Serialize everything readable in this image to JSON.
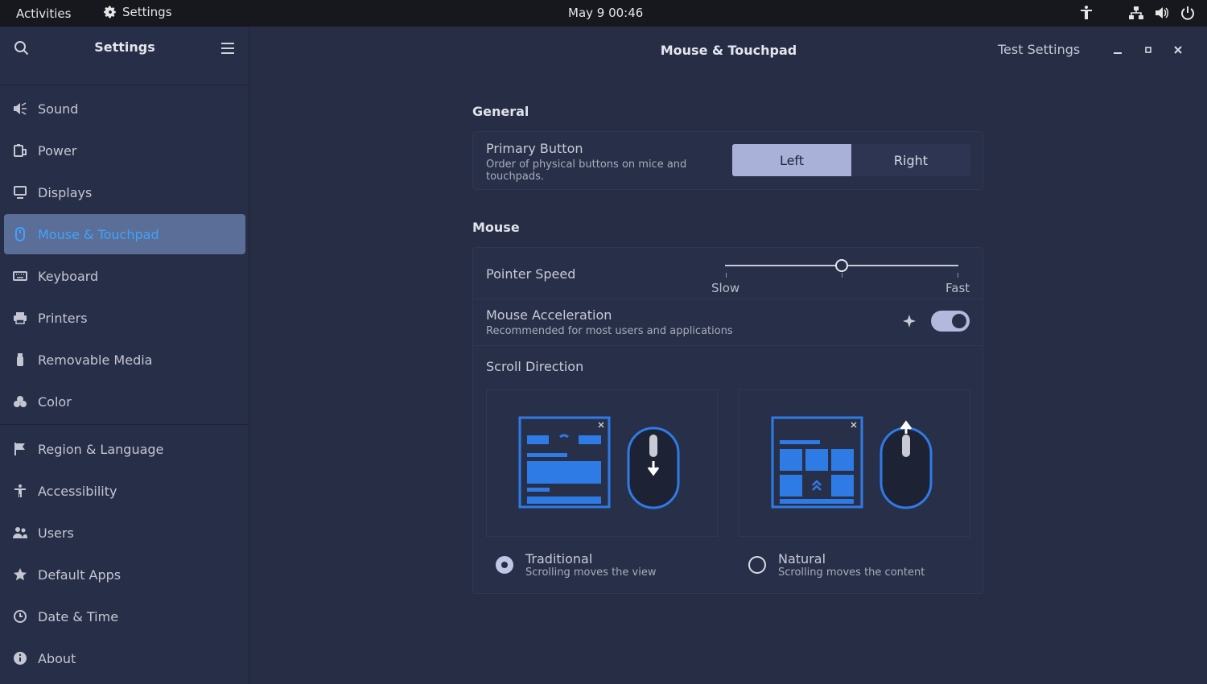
{
  "topbar": {
    "activities": "Activities",
    "app_name": "Settings",
    "clock": "May 9  00:46"
  },
  "sidebar": {
    "title": "Settings",
    "items": [
      {
        "label": "Sound",
        "icon": "speaker-icon"
      },
      {
        "label": "Power",
        "icon": "battery-icon"
      },
      {
        "label": "Displays",
        "icon": "monitor-icon"
      },
      {
        "label": "Mouse & Touchpad",
        "icon": "mouse-icon",
        "active": true
      },
      {
        "label": "Keyboard",
        "icon": "keyboard-icon"
      },
      {
        "label": "Printers",
        "icon": "printer-icon"
      },
      {
        "label": "Removable Media",
        "icon": "usb-icon"
      },
      {
        "label": "Color",
        "icon": "color-icon"
      },
      {
        "label": "Region & Language",
        "icon": "flag-icon"
      },
      {
        "label": "Accessibility",
        "icon": "accessibility-icon"
      },
      {
        "label": "Users",
        "icon": "users-icon"
      },
      {
        "label": "Default Apps",
        "icon": "star-icon"
      },
      {
        "label": "Date & Time",
        "icon": "clock-icon"
      },
      {
        "label": "About",
        "icon": "info-icon"
      }
    ]
  },
  "header": {
    "title": "Mouse & Touchpad",
    "test_button": "Test Settings"
  },
  "general": {
    "section_title": "General",
    "primary_button": {
      "title": "Primary Button",
      "subtitle": "Order of physical buttons on mice and touchpads.",
      "options": [
        "Left",
        "Right"
      ],
      "selected": "Left"
    }
  },
  "mouse": {
    "section_title": "Mouse",
    "pointer_speed": {
      "title": "Pointer Speed",
      "min_label": "Slow",
      "max_label": "Fast",
      "value": 0.5
    },
    "acceleration": {
      "title": "Mouse Acceleration",
      "subtitle": "Recommended for most users and applications",
      "enabled": true
    },
    "scroll_direction": {
      "title": "Scroll Direction",
      "options": [
        {
          "title": "Traditional",
          "subtitle": "Scrolling moves the view",
          "selected": true
        },
        {
          "title": "Natural",
          "subtitle": "Scrolling moves the content",
          "selected": false
        }
      ]
    }
  },
  "colors": {
    "accent": "#3fa2ff",
    "active_bg": "#5b6e97",
    "illustration_blue": "#2f7be6"
  }
}
